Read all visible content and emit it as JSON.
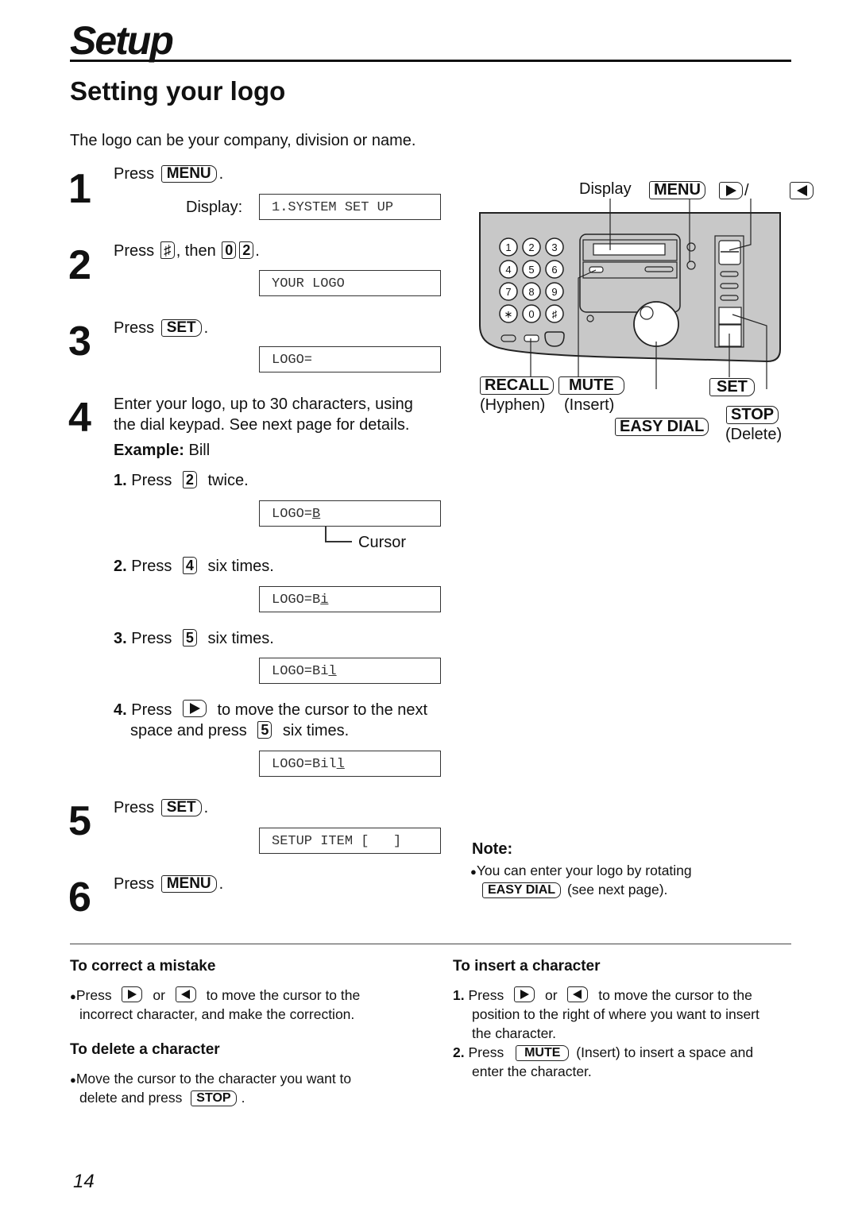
{
  "header": {
    "section_title": "Setup",
    "page_heading": "Setting your logo",
    "intro": "The logo can be your company, division or name."
  },
  "steps": [
    {
      "number": "1",
      "text_before": "Press",
      "key": "MENU",
      "text_after": ".",
      "display_label": "Display:",
      "display": "1.SYSTEM SET UP"
    },
    {
      "number": "2",
      "text_before": "Press",
      "key_hash": "♯",
      "text_mid": ", then",
      "digits": [
        "0",
        "2"
      ],
      "text_after": ".",
      "display": "YOUR LOGO"
    },
    {
      "number": "3",
      "text_before": "Press",
      "key": "SET",
      "text_after": ".",
      "display": "LOGO="
    },
    {
      "number": "4",
      "line1": "Enter your logo, up to 30 characters, using",
      "line2": "the dial keypad. See next page for details.",
      "example_label": "Example:",
      "example_value": "Bill",
      "substeps": [
        {
          "num": "1.",
          "press": "Press",
          "key": "2",
          "after": "twice.",
          "display_prefix": "LOGO=",
          "display_cursor": "B",
          "cursor_label": "Cursor"
        },
        {
          "num": "2.",
          "press": "Press",
          "key": "4",
          "after": "six times.",
          "display_prefix": "LOGO=B",
          "display_cursor": "i"
        },
        {
          "num": "3.",
          "press": "Press",
          "key": "5",
          "after": "six times.",
          "display_prefix": "LOGO=Bi",
          "display_cursor": "l"
        },
        {
          "num": "4.",
          "press": "Press",
          "after": "to move the cursor to the next",
          "line2_before": "space and press",
          "key": "5",
          "line2_after": "six times.",
          "display_prefix": "LOGO=Bil",
          "display_cursor": "l"
        }
      ]
    },
    {
      "number": "5",
      "text_before": "Press",
      "key": "SET",
      "text_after": ".",
      "display": "SETUP ITEM [   ]"
    },
    {
      "number": "6",
      "text_before": "Press",
      "key": "MENU",
      "text_after": "."
    }
  ],
  "diagram": {
    "display_label": "Display",
    "menu_key": "MENU",
    "slash": "/",
    "keypad": [
      "1",
      "2",
      "3",
      "4",
      "5",
      "6",
      "7",
      "8",
      "9",
      "∗",
      "0",
      "♯"
    ],
    "recall_key": "RECALL",
    "recall_sub": "(Hyphen)",
    "mute_key": "MUTE",
    "mute_sub": "(Insert)",
    "easy_dial_key": "EASY DIAL",
    "set_key": "SET",
    "stop_key": "STOP",
    "stop_sub": "(Delete)",
    "colors": {
      "panel": "#c8c8c8",
      "outline": "#222222"
    }
  },
  "note": {
    "title": "Note:",
    "bullet": "●",
    "line1": "You can enter your logo by rotating",
    "key": "EASY DIAL",
    "line2_after": "(see next page)."
  },
  "correct_mistake": {
    "title": "To correct a mistake",
    "bullet": "●",
    "press": "Press",
    "or": "or",
    "after": "to move the cursor to the",
    "line2": "incorrect character, and make the correction."
  },
  "delete_char": {
    "title": "To delete a character",
    "bullet": "●",
    "line1": "Move the cursor to the character you want to",
    "line2_before": "delete and press",
    "key": "STOP",
    "line2_after": "."
  },
  "insert_char": {
    "title": "To insert a character",
    "items": [
      {
        "num": "1.",
        "press": "Press",
        "or": "or",
        "after": "to move the cursor to the",
        "line2": "position to the right of where you want to insert",
        "line3": "the character."
      },
      {
        "num": "2.",
        "press": "Press",
        "key": "MUTE",
        "after": "(Insert) to insert a space and",
        "line2": "enter the character."
      }
    ]
  },
  "footer": {
    "page_number": "14"
  }
}
